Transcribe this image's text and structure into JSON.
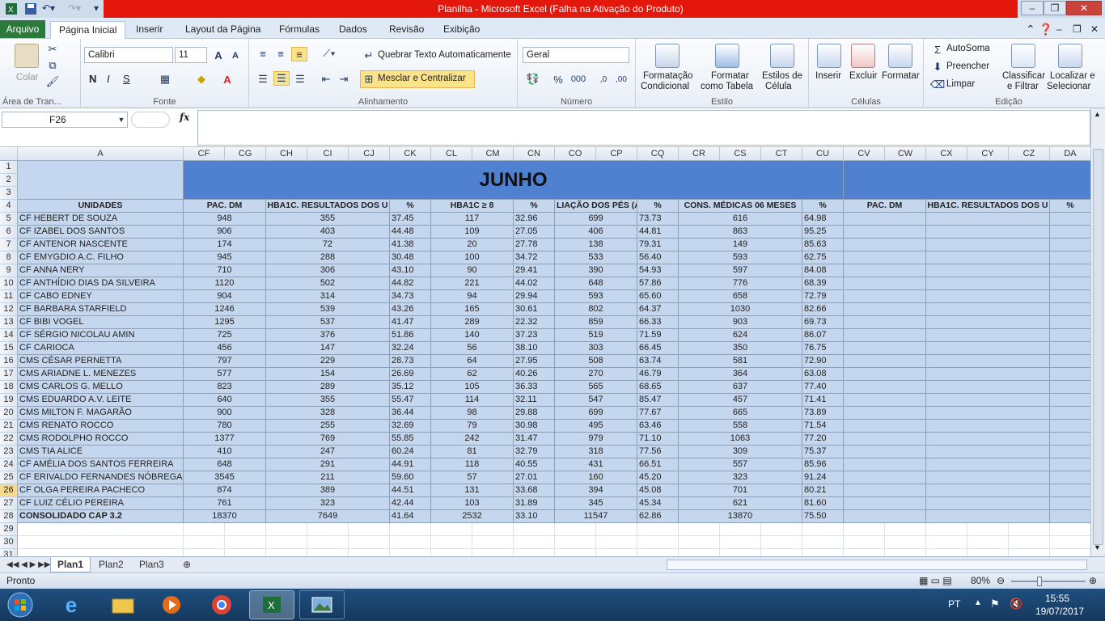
{
  "window": {
    "title": "Planilha -  Microsoft Excel (Falha na Ativação do Produto)",
    "minimize": "–",
    "restore": "❐",
    "close": "✕"
  },
  "menu": {
    "file": "Arquivo",
    "tabs": [
      "Página Inicial",
      "Inserir",
      "Layout da Página",
      "Fórmulas",
      "Dados",
      "Revisão",
      "Exibição"
    ]
  },
  "ribbon": {
    "clipboard": {
      "label": "Área de Tran...",
      "paste": "Colar"
    },
    "font": {
      "label": "Fonte",
      "name": "Calibri",
      "size": "11",
      "bold": "N",
      "italic": "I",
      "underline": "S"
    },
    "alignment": {
      "label": "Alinhamento",
      "wrap": "Quebrar Texto Automaticamente",
      "merge": "Mesclar e Centralizar"
    },
    "number": {
      "label": "Número",
      "format": "Geral"
    },
    "styles": {
      "label": "Estilo",
      "conditional1": "Formatação",
      "conditional2": "Condicional",
      "table1": "Formatar",
      "table2": "como Tabela",
      "cell1": "Estilos de",
      "cell2": "Célula"
    },
    "cells": {
      "label": "Células",
      "insert": "Inserir",
      "delete": "Excluir",
      "format": "Formatar"
    },
    "editing": {
      "label": "Edição",
      "autosum": "AutoSoma",
      "fill": "Preencher",
      "clear": "Limpar",
      "sort1": "Classificar",
      "sort2": "e Filtrar",
      "find1": "Localizar e",
      "find2": "Selecionar"
    }
  },
  "formula_bar": {
    "name_box": "F26",
    "fx": "fx",
    "value": ""
  },
  "columns": [
    "A",
    "CF",
    "CG",
    "CH",
    "CI",
    "CJ",
    "CK",
    "CL",
    "CM",
    "CN",
    "CO",
    "CP",
    "CQ",
    "CR",
    "CS",
    "CT",
    "CU",
    "CV",
    "CW",
    "CX",
    "CY",
    "CZ",
    "DA"
  ],
  "sheet": {
    "title": "JUNHO",
    "headers": {
      "unidades": "UNIDADES",
      "pac_dm": "PAC. DM",
      "hba1c": "HBA1C. RESULTADOS DOS U",
      "pct1": "%",
      "hba1c8": "HBA1C ≥ 8",
      "pct2": "%",
      "pes": "LIAÇÃO DOS PÉS (A",
      "pct3": "%",
      "cons": "CONS. MÉDICAS 06 MESES",
      "pct4": "%",
      "pac_dm2": "PAC. DM",
      "hba1c2": "HBA1C. RESULTADOS DOS U",
      "pct5": "%"
    },
    "rows": [
      {
        "n": "5",
        "name": "CF HEBERT DE SOUZA",
        "a": "948",
        "b": "355",
        "c": "37.45",
        "d": "117",
        "e": "32.96",
        "f": "699",
        "g": "73.73",
        "h": "616",
        "i": "64.98"
      },
      {
        "n": "6",
        "name": "CF IZABEL DOS SANTOS",
        "a": "906",
        "b": "403",
        "c": "44.48",
        "d": "109",
        "e": "27.05",
        "f": "406",
        "g": "44.81",
        "h": "863",
        "i": "95.25"
      },
      {
        "n": "7",
        "name": "CF ANTENOR NASCENTE",
        "a": "174",
        "b": "72",
        "c": "41.38",
        "d": "20",
        "e": "27.78",
        "f": "138",
        "g": "79.31",
        "h": "149",
        "i": "85.63"
      },
      {
        "n": "8",
        "name": "CF EMYGDIO A.C. FILHO",
        "a": "945",
        "b": "288",
        "c": "30.48",
        "d": "100",
        "e": "34.72",
        "f": "533",
        "g": "56.40",
        "h": "593",
        "i": "62.75"
      },
      {
        "n": "9",
        "name": "CF ANNA NERY",
        "a": "710",
        "b": "306",
        "c": "43.10",
        "d": "90",
        "e": "29.41",
        "f": "390",
        "g": "54.93",
        "h": "597",
        "i": "84.08"
      },
      {
        "n": "10",
        "name": "CF ANTHÍDIO DIAS DA SILVEIRA",
        "a": "1120",
        "b": "502",
        "c": "44.82",
        "d": "221",
        "e": "44.02",
        "f": "648",
        "g": "57.86",
        "h": "776",
        "i": "68.39"
      },
      {
        "n": "11",
        "name": "CF CABO EDNEY",
        "a": "904",
        "b": "314",
        "c": "34.73",
        "d": "94",
        "e": "29.94",
        "f": "593",
        "g": "65.60",
        "h": "658",
        "i": "72.79"
      },
      {
        "n": "12",
        "name": "CF BARBARA STARFIELD",
        "a": "1246",
        "b": "539",
        "c": "43.26",
        "d": "165",
        "e": "30.61",
        "f": "802",
        "g": "64.37",
        "h": "1030",
        "i": "82.66"
      },
      {
        "n": "13",
        "name": "CF BIBI VOGEL",
        "a": "1295",
        "b": "537",
        "c": "41.47",
        "d": "289",
        "e": "22.32",
        "f": "859",
        "g": "66.33",
        "h": "903",
        "i": "69.73"
      },
      {
        "n": "14",
        "name": "CF SÉRGIO NICOLAU AMIN",
        "a": "725",
        "b": "376",
        "c": "51.86",
        "d": "140",
        "e": "37.23",
        "f": "519",
        "g": "71.59",
        "h": "624",
        "i": "86.07"
      },
      {
        "n": "15",
        "name": "CF CARIOCA",
        "a": "456",
        "b": "147",
        "c": "32.24",
        "d": "56",
        "e": "38.10",
        "f": "303",
        "g": "66.45",
        "h": "350",
        "i": "76.75"
      },
      {
        "n": "16",
        "name": "CMS CÉSAR PERNETTA",
        "a": "797",
        "b": "229",
        "c": "28.73",
        "d": "64",
        "e": "27.95",
        "f": "508",
        "g": "63.74",
        "h": "581",
        "i": "72.90"
      },
      {
        "n": "17",
        "name": "CMS ARIADNE L. MENEZES",
        "a": "577",
        "b": "154",
        "c": "26.69",
        "d": "62",
        "e": "40.26",
        "f": "270",
        "g": "46.79",
        "h": "364",
        "i": "63.08"
      },
      {
        "n": "18",
        "name": "CMS CARLOS G. MELLO",
        "a": "823",
        "b": "289",
        "c": "35.12",
        "d": "105",
        "e": "36.33",
        "f": "565",
        "g": "68.65",
        "h": "637",
        "i": "77.40"
      },
      {
        "n": "19",
        "name": "CMS EDUARDO A.V. LEITE",
        "a": "640",
        "b": "355",
        "c": "55.47",
        "d": "114",
        "e": "32.11",
        "f": "547",
        "g": "85.47",
        "h": "457",
        "i": "71.41"
      },
      {
        "n": "20",
        "name": "CMS MILTON F. MAGARÃO",
        "a": "900",
        "b": "328",
        "c": "36.44",
        "d": "98",
        "e": "29.88",
        "f": "699",
        "g": "77.67",
        "h": "665",
        "i": "73.89"
      },
      {
        "n": "21",
        "name": "CMS RENATO ROCCO",
        "a": "780",
        "b": "255",
        "c": "32.69",
        "d": "79",
        "e": "30.98",
        "f": "495",
        "g": "63.46",
        "h": "558",
        "i": "71.54"
      },
      {
        "n": "22",
        "name": "CMS RODOLPHO ROCCO",
        "a": "1377",
        "b": "769",
        "c": "55.85",
        "d": "242",
        "e": "31.47",
        "f": "979",
        "g": "71.10",
        "h": "1063",
        "i": "77.20"
      },
      {
        "n": "23",
        "name": "CMS TIA ALICE",
        "a": "410",
        "b": "247",
        "c": "60.24",
        "d": "81",
        "e": "32.79",
        "f": "318",
        "g": "77.56",
        "h": "309",
        "i": "75.37"
      },
      {
        "n": "24",
        "name": "CF AMÉLIA DOS SANTOS FERREIRA",
        "a": "648",
        "b": "291",
        "c": "44.91",
        "d": "118",
        "e": "40.55",
        "f": "431",
        "g": "66.51",
        "h": "557",
        "i": "85.96"
      },
      {
        "n": "25",
        "name": "CF ERIVALDO FERNANDES NÓBREGA",
        "a": "3545",
        "b": "211",
        "c": "59.60",
        "d": "57",
        "e": "27.01",
        "f": "160",
        "g": "45.20",
        "h": "323",
        "i": "91.24"
      },
      {
        "n": "26",
        "name": "CF OLGA PEREIRA PACHECO",
        "a": "874",
        "b": "389",
        "c": "44.51",
        "d": "131",
        "e": "33.68",
        "f": "394",
        "g": "45.08",
        "h": "701",
        "i": "80.21"
      },
      {
        "n": "27",
        "name": "CF LUIZ CÉLIO PEREIRA",
        "a": "761",
        "b": "323",
        "c": "42.44",
        "d": "103",
        "e": "31.89",
        "f": "345",
        "g": "45.34",
        "h": "621",
        "i": "81.60"
      },
      {
        "n": "28",
        "name": "CONSOLIDADO CAP 3.2",
        "a": "18370",
        "b": "7649",
        "c": "41.64",
        "d": "2532",
        "e": "33.10",
        "f": "11547",
        "g": "62.86",
        "h": "13870",
        "i": "75.50"
      }
    ],
    "row_numbers_top": [
      "1",
      "2",
      "3",
      "4"
    ],
    "row_numbers_bottom": [
      "29",
      "30",
      "31"
    ]
  },
  "sheet_tabs": [
    "Plan1",
    "Plan2",
    "Plan3"
  ],
  "status": {
    "ready": "Pronto",
    "zoom": "80%"
  },
  "taskbar": {
    "lang": "PT",
    "time": "15:55",
    "date": "19/07/2017"
  }
}
